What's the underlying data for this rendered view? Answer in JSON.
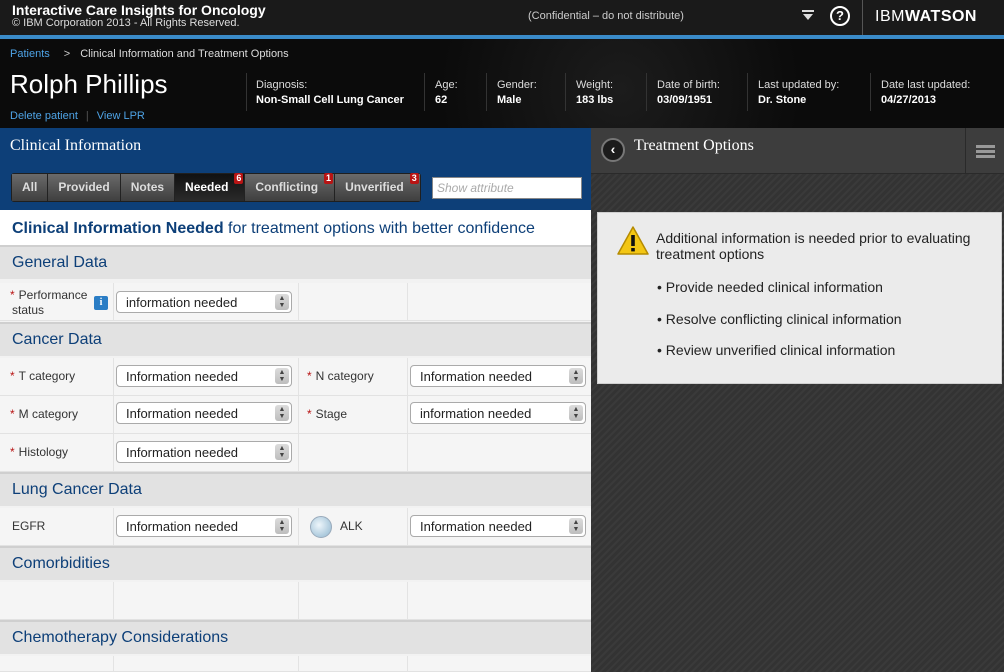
{
  "topbar": {
    "app_title": "Interactive Care Insights for Oncology",
    "copyright": "© IBM Corporation 2013 -  All Rights Reserved.",
    "confidential": "(Confidential – do not distribute)",
    "help_glyph": "?",
    "brand_light": "IBM",
    "brand_bold": "WATSON"
  },
  "breadcrumb": {
    "root": "Patients",
    "separator": ">",
    "current": "Clinical Information and Treatment Options"
  },
  "patient": {
    "name": "Rolph Phillips",
    "delete_link": "Delete patient",
    "view_lpr_link": "View LPR",
    "diagnosis_label": "Diagnosis:",
    "diagnosis": "Non-Small Cell Lung Cancer",
    "age_label": "Age:",
    "age": "62",
    "gender_label": "Gender:",
    "gender": "Male",
    "weight_label": "Weight:",
    "weight": "183 lbs",
    "dob_label": "Date of birth:",
    "dob": "03/09/1951",
    "updated_by_label": "Last updated by:",
    "updated_by": "Dr. Stone",
    "updated_date_label": "Date last updated:",
    "updated_date": "04/27/2013"
  },
  "clinical": {
    "title": "Clinical Information",
    "filters": [
      {
        "label": "All",
        "badge": ""
      },
      {
        "label": "Provided",
        "badge": ""
      },
      {
        "label": "Notes",
        "badge": ""
      },
      {
        "label": "Needed",
        "badge": "6",
        "active": true
      },
      {
        "label": "Conflicting",
        "badge": "1"
      },
      {
        "label": "Unverified",
        "badge": "3"
      }
    ],
    "search_placeholder": "Show attribute",
    "heading_bold": "Clinical Information Needed",
    "heading_rest": " for treatment options with better confidence",
    "sections": {
      "general": "General Data",
      "cancer": "Cancer Data",
      "lung": "Lung Cancer Data",
      "comorbidities": "Comorbidities",
      "chemo": "Chemotherapy Considerations"
    },
    "fields": {
      "performance_label_1": "Performance",
      "performance_label_2": "status",
      "performance_value": "information needed",
      "t_label": "T  category",
      "t_value": "Information needed",
      "n_label": "N  category",
      "n_value": "Information needed",
      "m_label": "M category",
      "m_value": "Information needed",
      "stage_label": "Stage",
      "stage_value": "information needed",
      "histology_label": "Histology",
      "histology_value": "Information needed",
      "egfr_label": "EGFR",
      "egfr_value": "Information needed",
      "alk_label": "ALK",
      "alk_value": "Information needed"
    },
    "required_mark": "*",
    "info_glyph": "i"
  },
  "treatment": {
    "title": "Treatment Options",
    "back_glyph": "‹",
    "notice": "Additional information is needed prior to evaluating treatment options",
    "bullets": [
      "• Provide needed clinical information",
      "• Resolve conflicting clinical information",
      "• Review unverified clinical information"
    ]
  },
  "icons": [
    "filter-icon",
    "help-icon",
    "info-icon",
    "globe-icon",
    "back-icon",
    "menu-icon",
    "warning-icon",
    "chevron-updown-icon"
  ],
  "colors": {
    "accent_blue": "#0d3f78",
    "link_blue": "#4ea3e6",
    "badge_red": "#b81414",
    "warning_yellow": "#f3c614"
  }
}
